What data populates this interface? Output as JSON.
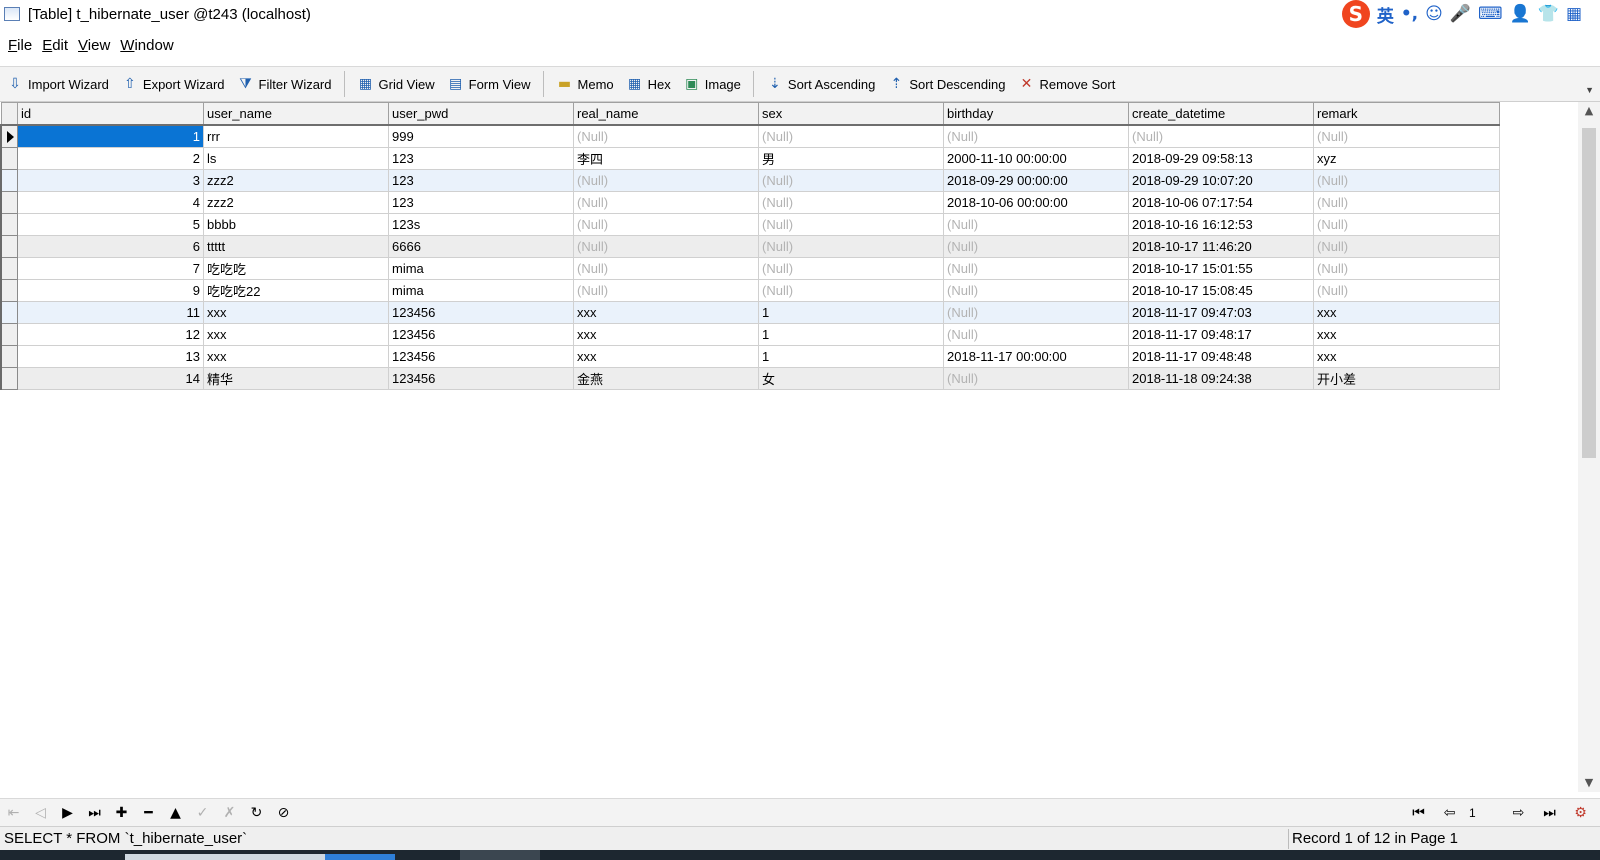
{
  "window": {
    "title": "[Table] t_hibernate_user @t243 (localhost)"
  },
  "ime": {
    "logo": "S",
    "items": [
      "英",
      "•,",
      "☺",
      "🎤",
      "⌨",
      "👤",
      "👕",
      "▦"
    ]
  },
  "menu": [
    "File",
    "Edit",
    "View",
    "Window"
  ],
  "toolbar": {
    "import_wizard": "Import Wizard",
    "export_wizard": "Export Wizard",
    "filter_wizard": "Filter Wizard",
    "grid_view": "Grid View",
    "form_view": "Form View",
    "memo": "Memo",
    "hex": "Hex",
    "image": "Image",
    "sort_ascending": "Sort Ascending",
    "sort_descending": "Sort Descending",
    "remove_sort": "Remove Sort"
  },
  "grid": {
    "columns": [
      "id",
      "user_name",
      "user_pwd",
      "real_name",
      "sex",
      "birthday",
      "create_datetime",
      "remark"
    ],
    "rows": [
      [
        "1",
        "rrr",
        "999",
        "(Null)",
        "(Null)",
        "(Null)",
        "(Null)",
        "(Null)"
      ],
      [
        "2",
        "ls",
        "123",
        "李四",
        "男",
        "2000-11-10 00:00:00",
        "2018-09-29 09:58:13",
        "xyz"
      ],
      [
        "3",
        "zzz2",
        "123",
        "(Null)",
        "(Null)",
        "2018-09-29 00:00:00",
        "2018-09-29 10:07:20",
        "(Null)"
      ],
      [
        "4",
        "zzz2",
        "123",
        "(Null)",
        "(Null)",
        "2018-10-06 00:00:00",
        "2018-10-06 07:17:54",
        "(Null)"
      ],
      [
        "5",
        "bbbb",
        "123s",
        "(Null)",
        "(Null)",
        "(Null)",
        "2018-10-16 16:12:53",
        "(Null)"
      ],
      [
        "6",
        "ttttt",
        "6666",
        "(Null)",
        "(Null)",
        "(Null)",
        "2018-10-17 11:46:20",
        "(Null)"
      ],
      [
        "7",
        "吃吃吃",
        "mima",
        "(Null)",
        "(Null)",
        "(Null)",
        "2018-10-17 15:01:55",
        "(Null)"
      ],
      [
        "9",
        "吃吃吃22",
        "mima",
        "(Null)",
        "(Null)",
        "(Null)",
        "2018-10-17 15:08:45",
        "(Null)"
      ],
      [
        "11",
        "xxx",
        "123456",
        "xxx",
        "1",
        "(Null)",
        "2018-11-17 09:47:03",
        "xxx"
      ],
      [
        "12",
        "xxx",
        "123456",
        "xxx",
        "1",
        "(Null)",
        "2018-11-17 09:48:17",
        "xxx"
      ],
      [
        "13",
        "xxx",
        "123456",
        "xxx",
        "1",
        "2018-11-17 00:00:00",
        "2018-11-17 09:48:48",
        "xxx"
      ],
      [
        "14",
        "精华",
        "123456",
        "金燕",
        "女",
        "(Null)",
        "2018-11-18 09:24:38",
        "开小差"
      ]
    ],
    "null_text": "(Null)"
  },
  "navigation": {
    "page_value": "1"
  },
  "status": {
    "sql": "SELECT * FROM `t_hibernate_user`",
    "record": "Record 1 of 12 in Page 1"
  },
  "colors": {
    "selection": "#0a74d4",
    "null_text": "#b3b3b3",
    "accent": "#1f5fae"
  }
}
